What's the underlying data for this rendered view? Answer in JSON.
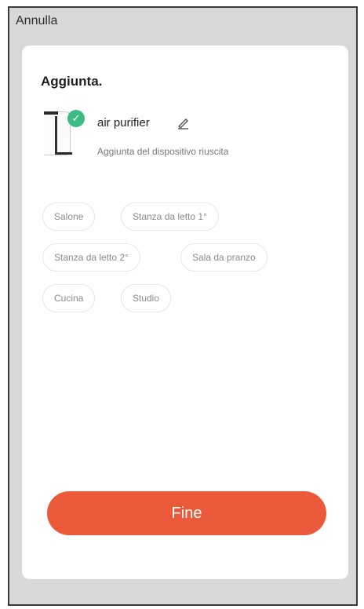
{
  "header": {
    "cancel_label": "Annulla"
  },
  "card": {
    "title": "Aggiunta.",
    "device": {
      "name": "air purifier",
      "status": "Aggiunta del dispositivo riuscita",
      "icon": "air-purifier-icon",
      "badge_icon": "check-icon"
    },
    "rooms": [
      "Salone",
      "Stanza da letto 1°",
      "Stanza da letto 2°",
      "Sala da pranzo",
      "Cucina",
      "Studio"
    ]
  },
  "footer": {
    "done_label": "Fine"
  },
  "colors": {
    "accent": "#ea5a3a",
    "success": "#3dbb84",
    "background": "#d8d9d6"
  }
}
